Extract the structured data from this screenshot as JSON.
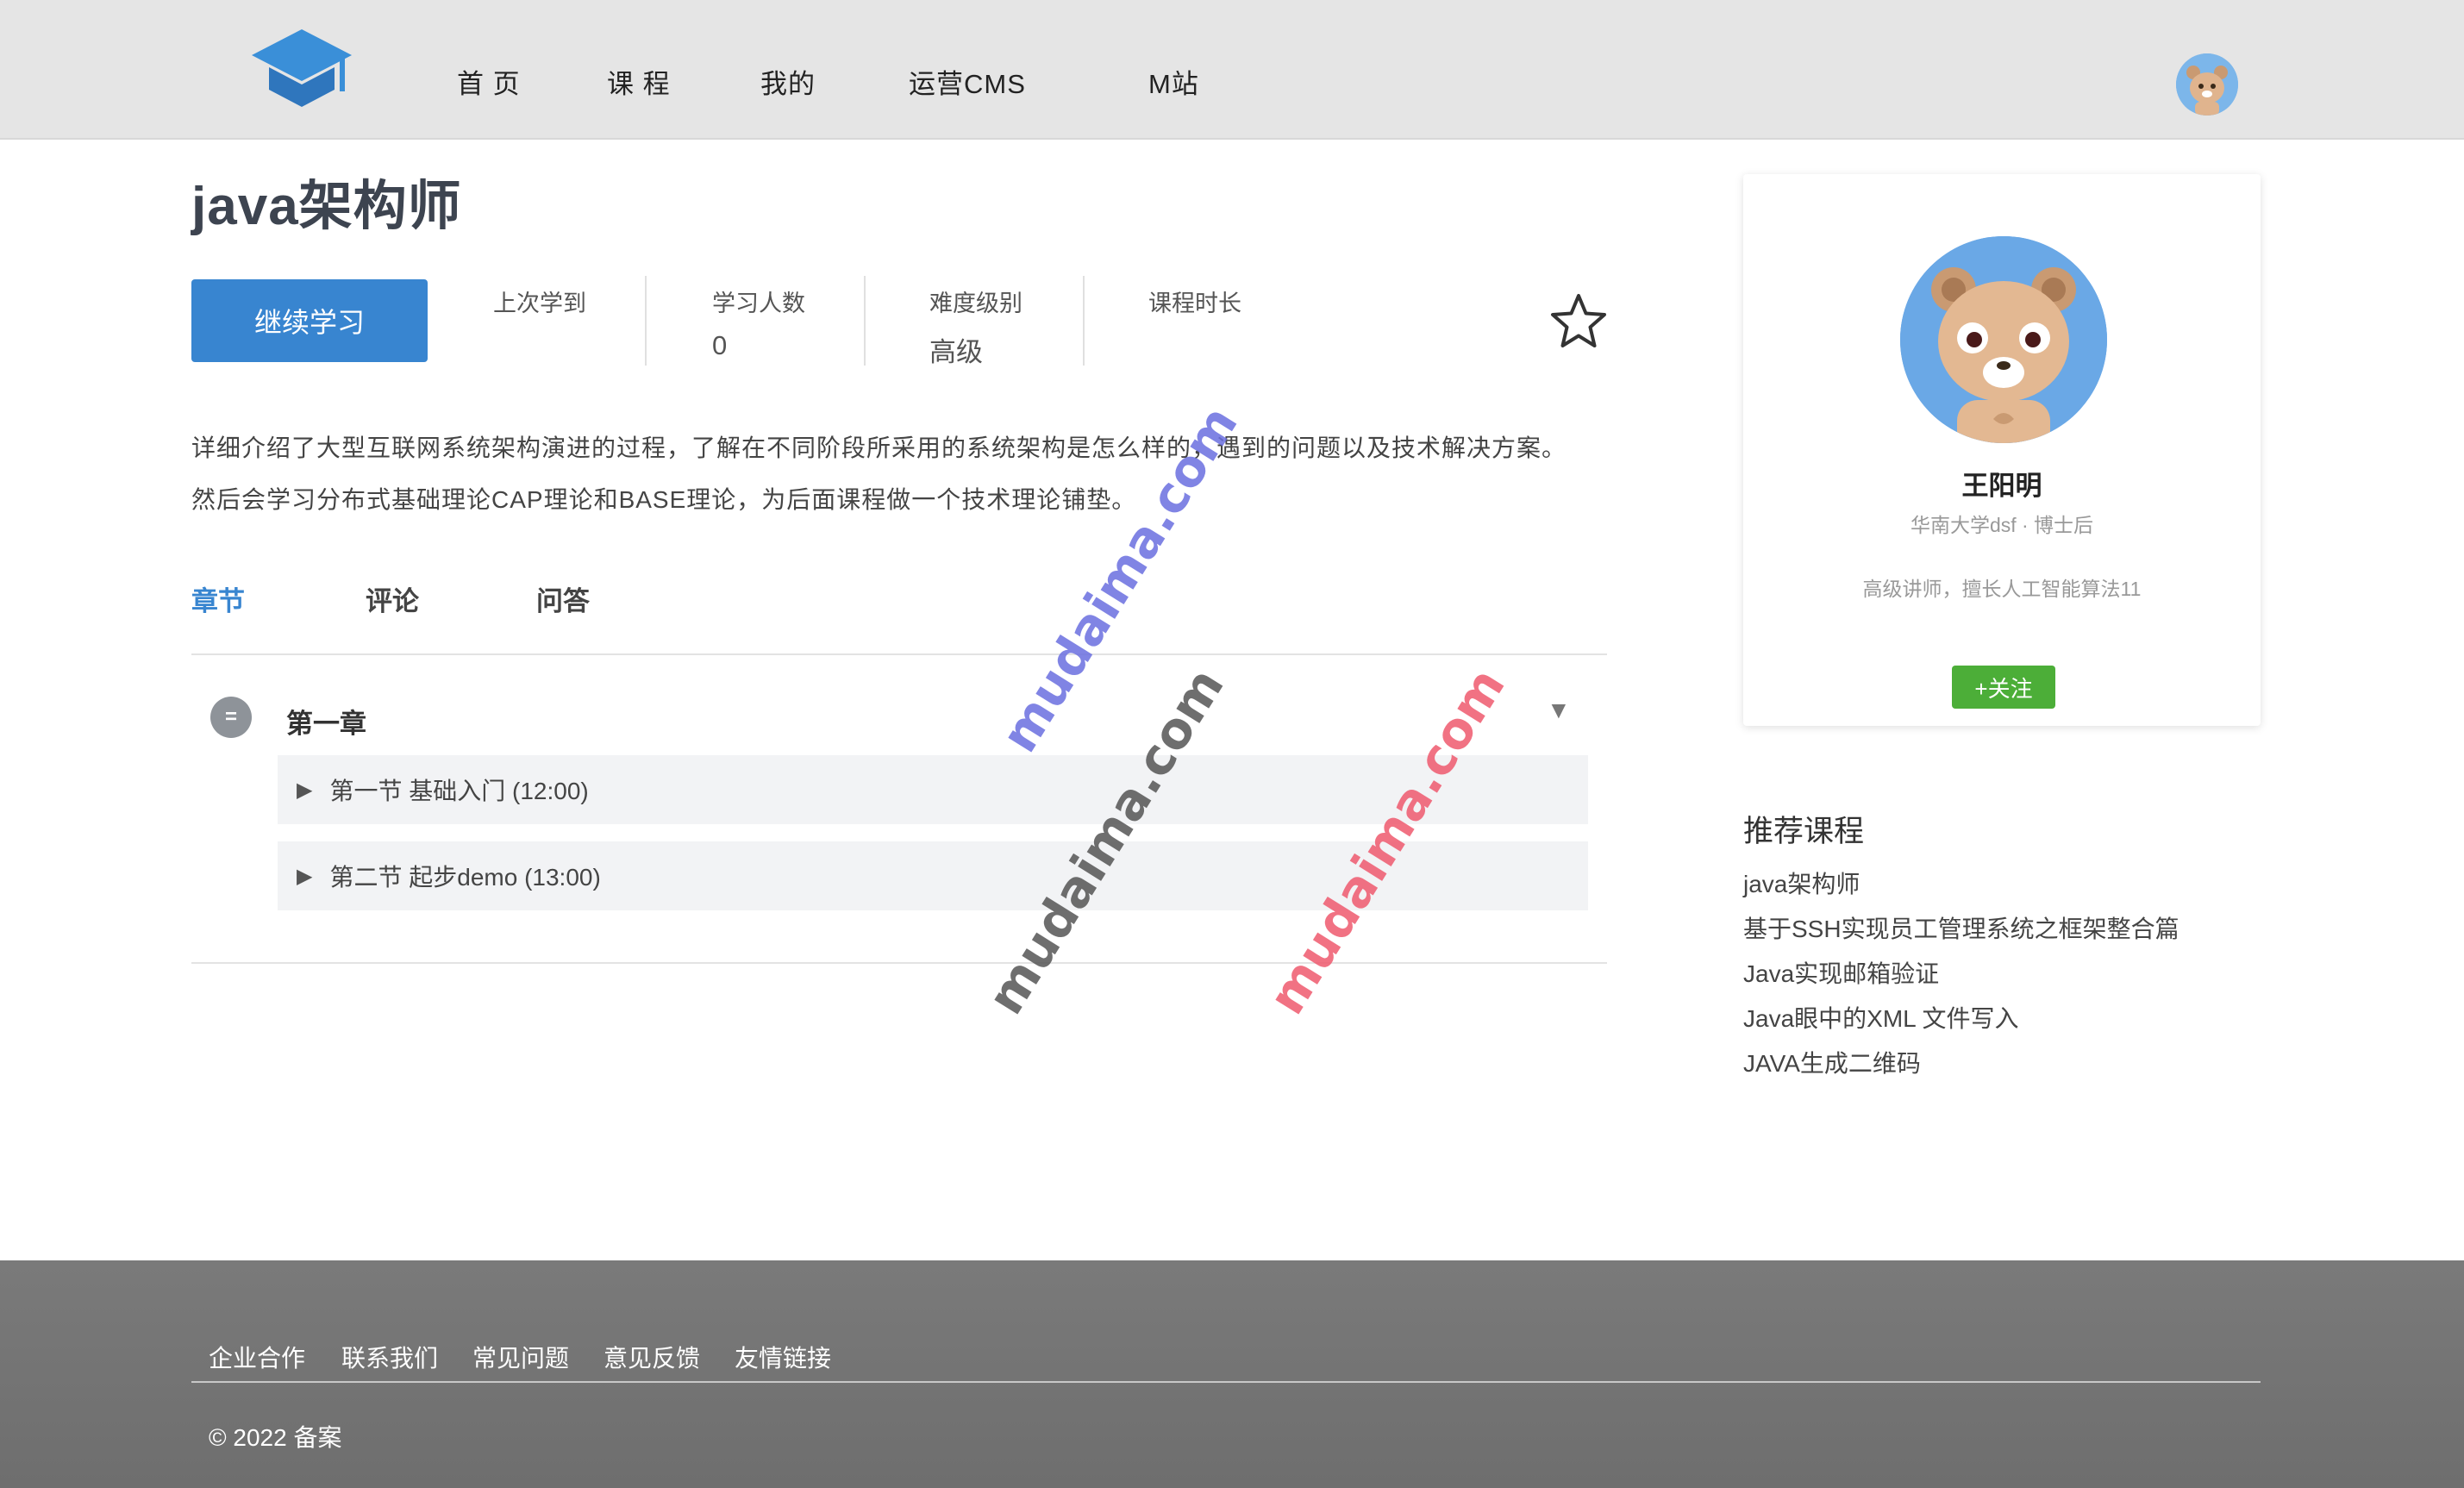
{
  "nav": {
    "items": [
      "首 页",
      "课 程",
      "我的",
      "运营CMS",
      "M站"
    ]
  },
  "course": {
    "title": "java架构师",
    "continue_label": "继续学习",
    "stats": [
      {
        "label": "上次学到",
        "value": ""
      },
      {
        "label": "学习人数",
        "value": "0"
      },
      {
        "label": "难度级别",
        "value": "高级"
      },
      {
        "label": "课程时长",
        "value": ""
      }
    ],
    "description": "详细介绍了大型互联网系统架构演进的过程，了解在不同阶段所采用的系统架构是怎么样的，遇到的问题以及技术解决方案。然后会学习分布式基础理论CAP理论和BASE理论，为后面课程做一个技术理论铺垫。"
  },
  "tabs": [
    "章节",
    "评论",
    "问答"
  ],
  "chapters": [
    {
      "badge": "=",
      "title": "第一章",
      "toggle": "▼",
      "sections": [
        "第一节 基础入门 (12:00)",
        "第二节 起步demo (13:00)"
      ]
    }
  ],
  "teacher": {
    "name": "王阳明",
    "school": "华南大学dsf · 博士后",
    "bio": "高级讲师，擅长人工智能算法11",
    "follow_label": "+关注"
  },
  "recommend": {
    "title": "推荐课程",
    "items": [
      "java架构师",
      "基于SSH实现员工管理系统之框架整合篇",
      "Java实现邮箱验证",
      "Java眼中的XML 文件写入",
      "JAVA生成二维码"
    ]
  },
  "footer": {
    "links": [
      "企业合作",
      "联系我们",
      "常见问题",
      "意见反馈",
      "友情链接"
    ],
    "copyright": "© 2022  备案"
  },
  "watermarks": [
    "mudaima.com",
    "mudaima.com",
    "mudaima.com"
  ],
  "colors": {
    "accent": "#3885d0",
    "follow": "#4cae38",
    "header_bg": "#e5e5e5",
    "footer_bg": "#737373",
    "watermark_blue": "#6b6fe0",
    "watermark_dark": "#555555",
    "watermark_red": "#ef5a6e"
  },
  "icons": {
    "logo": "graduation-cap-icon",
    "favorite": "star-outline-icon",
    "section_expand": "play-triangle-icon",
    "avatar": "bear-avatar"
  }
}
